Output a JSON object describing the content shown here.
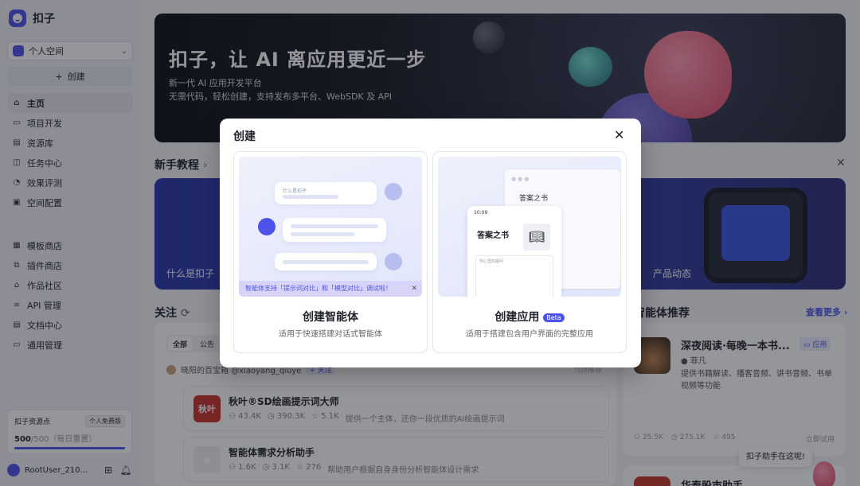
{
  "app": {
    "name": "扣子"
  },
  "sidebar": {
    "space": "个人空间",
    "create_label": "创建",
    "nav_primary": [
      {
        "id": "home",
        "label": "主页",
        "icon": "home-icon",
        "glyph": "⌂",
        "active": true
      },
      {
        "id": "projects",
        "label": "项目开发",
        "icon": "project-icon",
        "glyph": "▭",
        "active": false
      },
      {
        "id": "library",
        "label": "资源库",
        "icon": "library-icon",
        "glyph": "▤",
        "active": false
      },
      {
        "id": "tasks",
        "label": "任务中心",
        "icon": "task-icon",
        "glyph": "◫",
        "active": false
      },
      {
        "id": "evaluation",
        "label": "效果评测",
        "icon": "gauge-icon",
        "glyph": "◔",
        "active": false
      },
      {
        "id": "space-config",
        "label": "空间配置",
        "icon": "settings-icon",
        "glyph": "▣",
        "active": false
      }
    ],
    "nav_secondary": [
      {
        "id": "template-store",
        "label": "模板商店",
        "icon": "template-icon",
        "glyph": "▦"
      },
      {
        "id": "plugin-store",
        "label": "插件商店",
        "icon": "plugin-icon",
        "glyph": "⧉"
      },
      {
        "id": "community",
        "label": "作品社区",
        "icon": "community-icon",
        "glyph": "⌂"
      },
      {
        "id": "api",
        "label": "API 管理",
        "icon": "link-icon",
        "glyph": "∞"
      },
      {
        "id": "docs",
        "label": "文档中心",
        "icon": "doc-icon",
        "glyph": "▤"
      },
      {
        "id": "general",
        "label": "通用管理",
        "icon": "manage-icon",
        "glyph": "▭"
      }
    ],
    "resource": {
      "title": "扣子资源点",
      "plan": "个人免费版",
      "count": "500",
      "total": "/500（每日重置）",
      "fraction": 1.0
    },
    "user": {
      "name": "RootUser_210..."
    }
  },
  "banner": {
    "title": "扣子，让 AI 离应用更近一步",
    "subtitle1": "新一代 AI 应用开发平台",
    "subtitle2": "无需代码，轻松创建，支持发布多平台、WebSDK 及 API"
  },
  "tutorial": {
    "title": "新手教程",
    "arrow": "›",
    "left_label": "什么是扣子",
    "right_label": "产品动态"
  },
  "follow": {
    "title": "关注",
    "tabs": [
      "全部",
      "公告"
    ],
    "author": "晓阳的百宝箱 @xiaoyang_qiuye",
    "follow_tag": "+ 关注",
    "rec_hint": "为你推荐",
    "items": [
      {
        "name": "秋叶®SD绘画提示词大师",
        "stat1": "43.4K",
        "stat2": "390.3K",
        "stat3": "5.1K",
        "desc": "提供一个主体，还你一段优质的AI绘画提示词",
        "thumb_color": "#c8332b",
        "thumb_text": "秋叶"
      },
      {
        "name": "智能体需求分析助手",
        "stat1": "1.6K",
        "stat2": "3.1K",
        "stat3": "276",
        "desc": "帮助用户根据自身身份分析智能体设计需求",
        "thumb_color": "#eef0f5",
        "thumb_text": "▣"
      }
    ]
  },
  "recommend": {
    "title": "智能体推荐",
    "more": "查看更多 ›",
    "card": {
      "name": "深夜阅读·每晚一本书...",
      "tag": "应用",
      "author": "菲凡",
      "desc": "提供书籍解读、播客音频、讲书音频、书单视频等功能",
      "stat1": "25.5K",
      "stat2": "275.1K",
      "stat3": "495",
      "action": "立即试用"
    },
    "card2_name": "华泰股市助手"
  },
  "helper": {
    "text": "扣子助手在这呢!"
  },
  "modal": {
    "title": "创建",
    "options": [
      {
        "id": "agent",
        "title": "创建智能体",
        "desc": "适用于快速搭建对话式智能体",
        "illus_q": "什么是扣子",
        "notice": "智能体支持「提示词对比」和「模型对比」调试啦！",
        "beta": ""
      },
      {
        "id": "app",
        "title": "创建应用",
        "desc": "适用于搭建包含用户界面的完整应用",
        "illus_window": "答案之书",
        "illus_phone_title": "答案之书",
        "illus_time": "10:09",
        "illus_input": "你心里的疑问",
        "beta": "Beta"
      }
    ]
  }
}
